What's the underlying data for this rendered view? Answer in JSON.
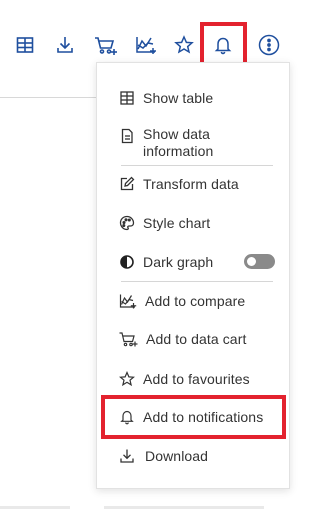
{
  "toolbar": {
    "icons": [
      {
        "name": "table-icon"
      },
      {
        "name": "download-icon"
      },
      {
        "name": "add-to-cart-icon"
      },
      {
        "name": "compare-chart-icon"
      },
      {
        "name": "favourite-star-icon"
      },
      {
        "name": "notification-bell-icon"
      },
      {
        "name": "more-options-icon"
      }
    ],
    "accent_color": "#1f4f9e"
  },
  "menu": {
    "items": [
      {
        "label": "Show table",
        "icon": "table-icon"
      },
      {
        "label": "Show data information",
        "label_line1": "Show data",
        "label_line2": "information",
        "icon": "document-icon"
      },
      {
        "label": "Transform data",
        "icon": "edit-icon"
      },
      {
        "label": "Style chart",
        "icon": "palette-icon"
      },
      {
        "label": "Dark graph",
        "icon": "contrast-icon",
        "toggle_on": false
      },
      {
        "label": "Add to compare",
        "icon": "compare-chart-icon"
      },
      {
        "label": "Add to data cart",
        "icon": "cart-icon"
      },
      {
        "label": "Add to favourites",
        "icon": "star-icon"
      },
      {
        "label": "Add to notifications",
        "icon": "bell-icon"
      },
      {
        "label": "Download",
        "icon": "download-icon"
      }
    ]
  },
  "highlight_color": "#e3222e"
}
